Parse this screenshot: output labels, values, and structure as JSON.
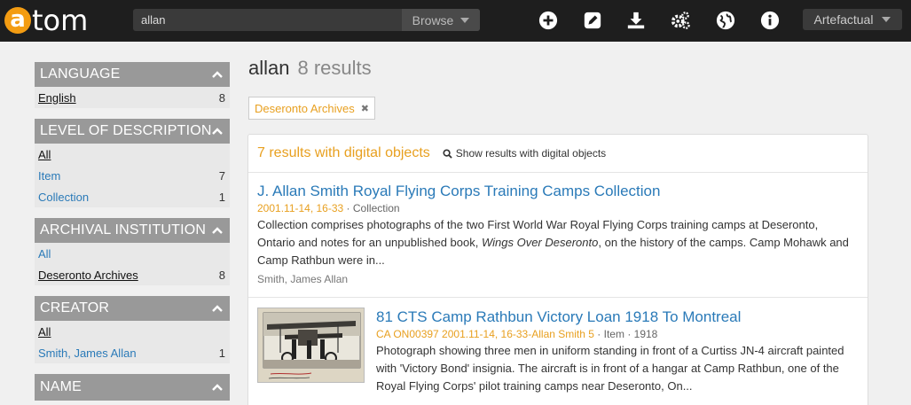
{
  "header": {
    "logo_text": "atom",
    "search_value": "allan",
    "browse_label": "Browse",
    "culture_label": "Artefactual",
    "icons": [
      "plus-circle-icon",
      "edit-icon",
      "download-icon",
      "gears-icon",
      "globe-icon",
      "info-icon"
    ]
  },
  "facets": [
    {
      "title": "LANGUAGE",
      "rows": [
        {
          "label": "English",
          "count": "8",
          "active": true
        }
      ]
    },
    {
      "title": "LEVEL OF DESCRIPTION",
      "rows": [
        {
          "label": "All",
          "count": "",
          "active": true
        },
        {
          "label": "Item",
          "count": "7",
          "active": false
        },
        {
          "label": "Collection",
          "count": "1",
          "active": false
        }
      ]
    },
    {
      "title": "ARCHIVAL INSTITUTION",
      "rows": [
        {
          "label": "All",
          "count": "",
          "active": false
        },
        {
          "label": "Deseronto Archives",
          "count": "8",
          "active": true
        }
      ]
    },
    {
      "title": "CREATOR",
      "rows": [
        {
          "label": "All",
          "count": "",
          "active": true
        },
        {
          "label": "Smith, James Allan",
          "count": "1",
          "active": false
        }
      ]
    },
    {
      "title": "NAME",
      "rows": []
    }
  ],
  "main": {
    "query": "allan",
    "result_count": "8 results",
    "filter_tag": "Deseronto Archives",
    "digital_count": "7 results with digital objects",
    "digital_link": "Show results with digital objects",
    "results": [
      {
        "title": "J. Allan Smith Royal Flying Corps Training Camps Collection",
        "ref": "2001.11-14, 16-33",
        "level": "Collection",
        "date": "",
        "desc_before": "Collection comprises photographs of the two First World War Royal Flying Corps training camps at Deseronto, Ontario and notes for an unpublished book, ",
        "desc_italic": "Wings Over Deseronto",
        "desc_after": ", on the history of the camps. Camp Mohawk and Camp Rathbun were in...",
        "creator": "Smith, James Allan"
      },
      {
        "title": "81 CTS Camp Rathbun Victory Loan 1918 To Montreal",
        "ref": "CA ON00397 2001.11-14, 16-33-Allan Smith 5",
        "level": "Item",
        "date": "1918",
        "desc_before": "Photograph showing three men in uniform standing in front of a Curtiss JN-4 aircraft painted with 'Victory Bond' insignia. The aircraft is in front of a hangar at Camp Rathbun, one of the Royal Flying Corps' pilot training camps near Deseronto, On...",
        "desc_italic": "",
        "desc_after": "",
        "creator": ""
      }
    ]
  },
  "colors": {
    "accent": "#e8a020",
    "link": "#2a7ab8",
    "header_bg": "#1e1e1e",
    "facet_head": "#999999"
  }
}
